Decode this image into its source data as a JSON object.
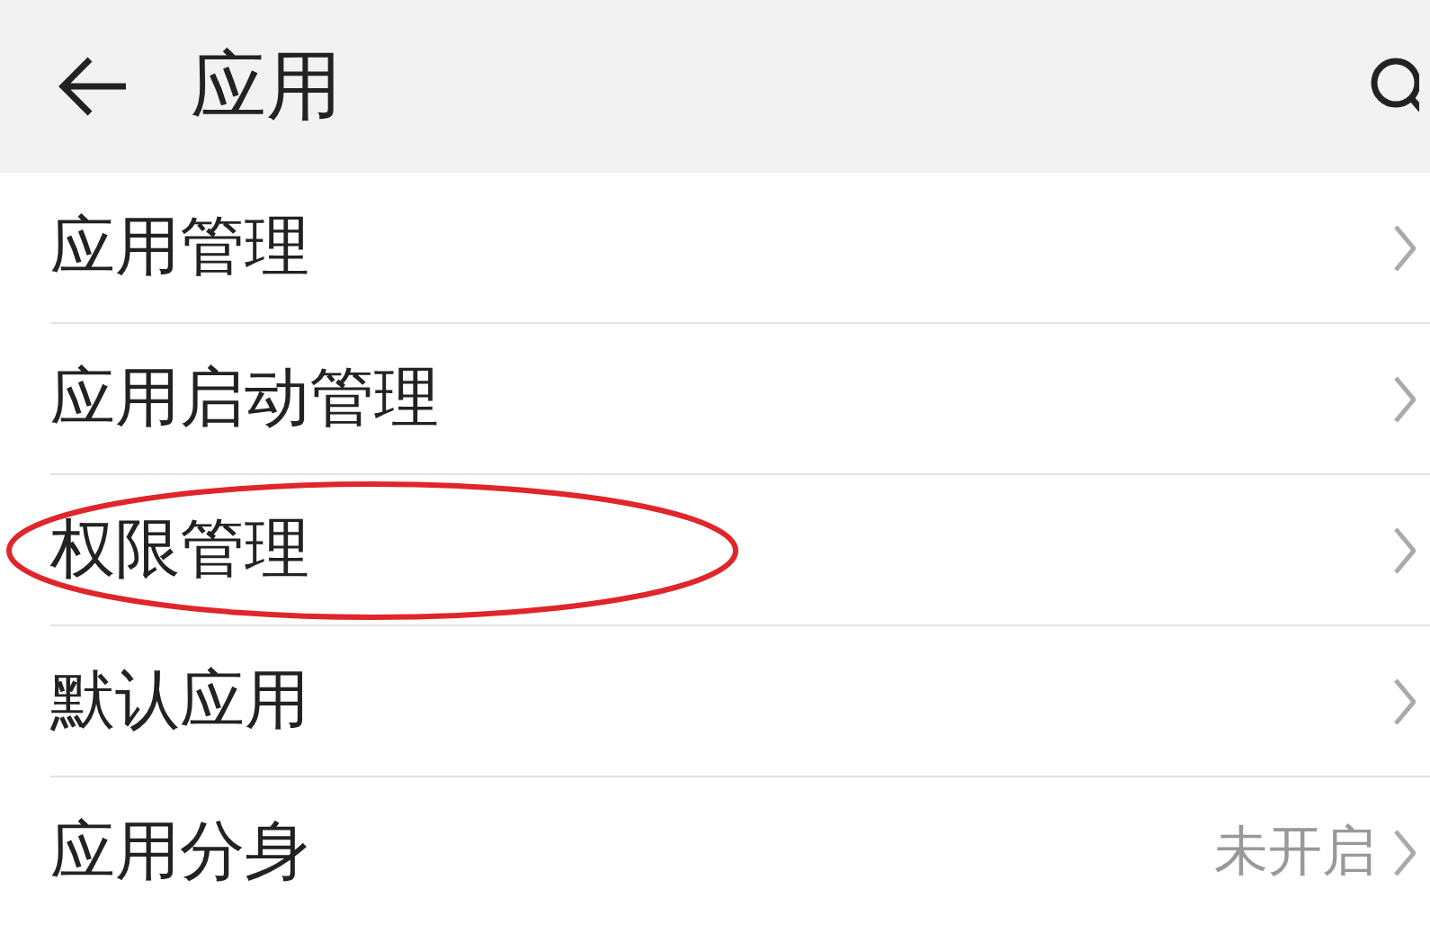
{
  "header": {
    "title": "应用"
  },
  "items": [
    {
      "label": "应用管理",
      "circled": false
    },
    {
      "label": "应用启动管理",
      "circled": false
    },
    {
      "label": "权限管理",
      "circled": true
    },
    {
      "label": "默认应用",
      "circled": false
    },
    {
      "label": "应用分身",
      "value": "未开启",
      "circled": false
    }
  ]
}
